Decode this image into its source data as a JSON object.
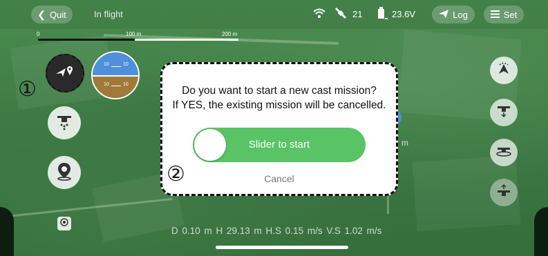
{
  "topbar": {
    "quit_label": "Quit",
    "status": "In flight",
    "satellites": "21",
    "battery_voltage": "23.6V",
    "log_label": "Log",
    "set_label": "Set"
  },
  "scale": {
    "tick_0": "0",
    "tick_100": "100 m",
    "tick_200": "200 m"
  },
  "attitude": {
    "upper_left": "10",
    "upper_right": "10",
    "lower_left": "10",
    "lower_right": "10"
  },
  "map_text": {
    "partial_unit": "m"
  },
  "dialog": {
    "message_line1": "Do you want to start a new cast mission?",
    "message_line2": "If YES, the existing mission will be cancelled.",
    "slider_label": "Slider to start",
    "cancel_label": "Cancel"
  },
  "annotations": {
    "marker_1": "①",
    "marker_2": "②"
  },
  "telemetry": {
    "text": "D 0.10 m   H 29.13 m   H.S 0.15 m/s   V.S 1.02 m/s"
  },
  "colors": {
    "accent_green": "#58c465",
    "map_green": "#3e7b44",
    "sky_blue": "#4f8fdc",
    "ground_brown": "#a07a3a"
  }
}
